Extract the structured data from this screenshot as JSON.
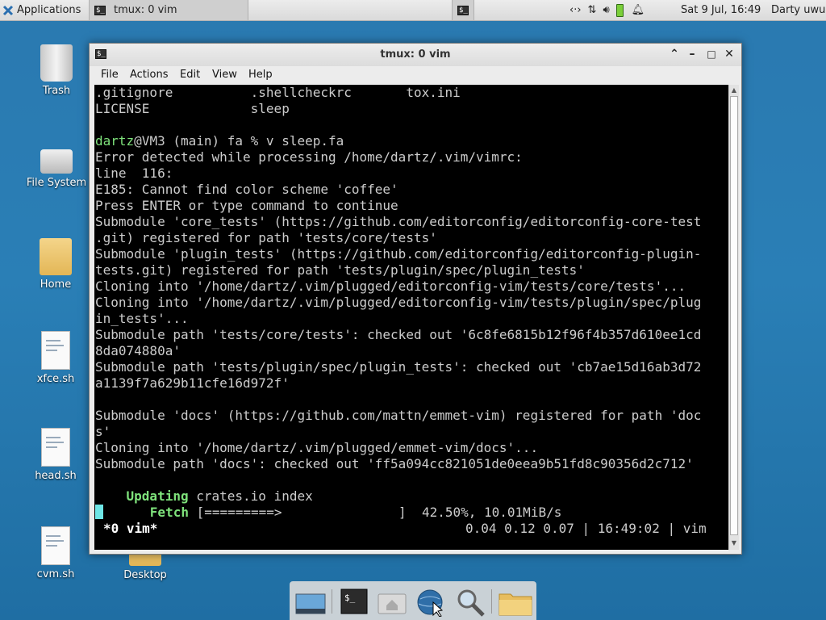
{
  "panel": {
    "applications_label": "Applications",
    "task_title": "tmux: 0 vim",
    "tray_icons": [
      "network-icon",
      "transfer-icon",
      "volume-icon",
      "battery-icon",
      "notification-bell-icon"
    ],
    "clock": "Sat  9 Jul, 16:49",
    "user": "Darty uwu"
  },
  "desktop_icons": [
    {
      "label": "Trash",
      "icon": "trash-icon"
    },
    {
      "label": "File System",
      "icon": "drive-icon"
    },
    {
      "label": "Home",
      "icon": "home-folder-icon"
    },
    {
      "label": "xfce.sh",
      "icon": "script-file-icon"
    },
    {
      "label": "head.sh",
      "icon": "script-file-icon"
    },
    {
      "label": "cvm.sh",
      "icon": "script-file-icon"
    },
    {
      "label": "Desktop",
      "icon": "folder-icon"
    }
  ],
  "window": {
    "title": "tmux: 0 vim",
    "menus": [
      "File",
      "Actions",
      "Edit",
      "View",
      "Help"
    ]
  },
  "terminal": {
    "lines": [
      ".gitignore          .shellcheckrc       tox.ini",
      "LICENSE             sleep",
      "",
      "",
      "Error detected while processing /home/dartz/.vim/vimrc:",
      "line  116:",
      "E185: Cannot find color scheme 'coffee'",
      "Press ENTER or type command to continue",
      "Submodule 'core_tests' (https://github.com/editorconfig/editorconfig-core-test",
      ".git) registered for path 'tests/core/tests'",
      "Submodule 'plugin_tests' (https://github.com/editorconfig/editorconfig-plugin-",
      "tests.git) registered for path 'tests/plugin/spec/plugin_tests'",
      "Cloning into '/home/dartz/.vim/plugged/editorconfig-vim/tests/core/tests'...",
      "Cloning into '/home/dartz/.vim/plugged/editorconfig-vim/tests/plugin/spec/plug",
      "in_tests'...",
      "Submodule path 'tests/core/tests': checked out '6c8fe6815b12f96f4b357d610ee1cd",
      "8da074880a'",
      "Submodule path 'tests/plugin/spec/plugin_tests': checked out 'cb7ae15d16ab3d72",
      "a1139f7a629b11cfe16d972f'",
      "",
      "Submodule 'docs' (https://github.com/mattn/emmet-vim) registered for path 'doc",
      "s'",
      "Cloning into '/home/dartz/.vim/plugged/emmet-vim/docs'...",
      "Submodule path 'docs': checked out 'ff5a094cc821051de0eea9b51fd8c90356d2c712'"
    ],
    "prompt_user": "dartz",
    "prompt_rest": "@VM3 (main) fa % v sleep.fa",
    "updating_label": "Updating",
    "updating_rest": " crates.io index",
    "fetch_label": "Fetch",
    "fetch_bar": " [=========>               ]  42.50%, 10.01MiB/s",
    "fetch_progress_percent": 42.5,
    "status_left": "*0 vim*",
    "status_right": "0.04 0.12 0.07 | 16:49:02 | vim"
  }
}
